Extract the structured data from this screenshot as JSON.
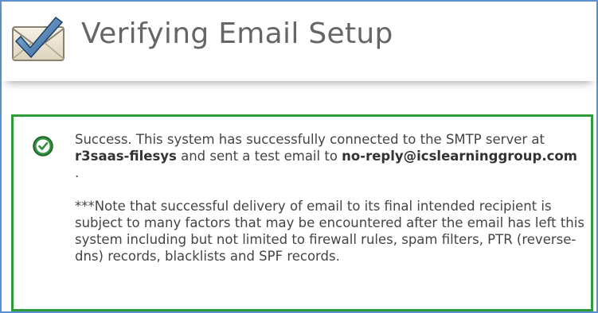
{
  "header": {
    "icon": "email-check-icon",
    "title": "Verifying Email Setup"
  },
  "panel": {
    "status_icon": "success-check-icon",
    "success_prefix": "Success. This system has successfully connected to the SMTP server at ",
    "server": "r3saas-filesys",
    "success_middle": " and sent a test email to ",
    "email": "no-reply@icslearninggroup.com",
    "success_suffix": " .",
    "note": "***Note that successful delivery of email to its final intended recipient is subject to many factors that may be encountered after the email has left this system including but not limited to firewall rules, spam filters, PTR (reverse-dns) records, blacklists and SPF records."
  },
  "colors": {
    "frame_border": "#5b8fd0",
    "panel_border": "#2e9b3a",
    "title_text": "#666666",
    "body_text": "#444444"
  }
}
